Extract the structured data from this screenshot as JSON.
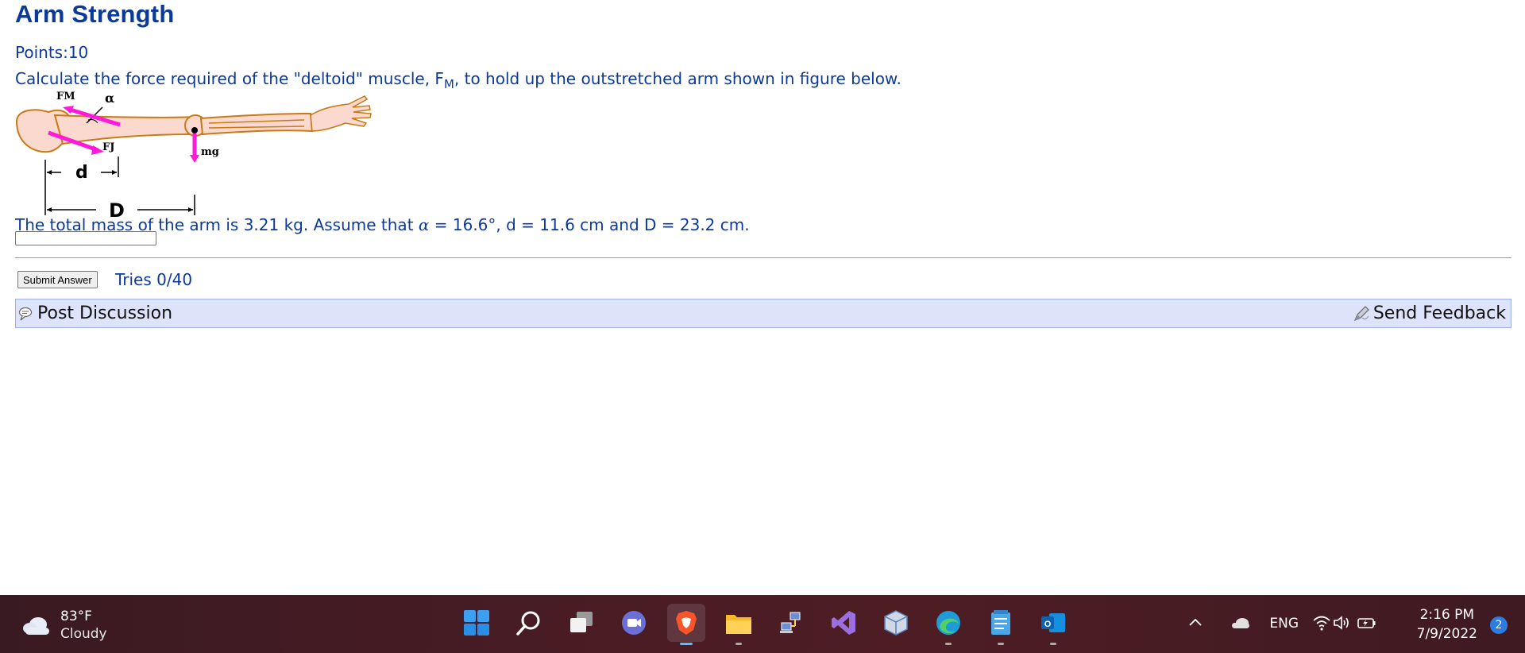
{
  "problem": {
    "title": "Arm Strength",
    "points": "Points:10",
    "question_pre": "Calculate the force required of the \"deltoid\" muscle, F",
    "question_sub": "M",
    "question_post": ", to hold up the outstretched arm shown in figure below.",
    "mass_text_pre": "The total mass of the arm is 3.21 kg. Assume that ",
    "alpha_symbol": "α",
    "mass_text_post": " = 16.6°, d = 11.6 cm and D = 23.2 cm.",
    "answer_value": "",
    "submit_label": "Submit Answer",
    "tries": "Tries 0/40",
    "post_discussion": "Post Discussion",
    "send_feedback": "Send Feedback"
  },
  "figure": {
    "label_fm": "FM",
    "label_alpha": "α",
    "label_fj": "FJ",
    "label_mg": "mg",
    "label_d": "d",
    "label_D": "D"
  },
  "taskbar": {
    "temperature": "83°F",
    "condition": "Cloudy",
    "icons": [
      "windows-start",
      "search",
      "task-view",
      "teams-chat",
      "brave-browser",
      "file-explorer",
      "network-app",
      "visual-studio",
      "virtualbox",
      "edge-browser",
      "notepad",
      "outlook"
    ],
    "language": "ENG",
    "time": "2:16 PM",
    "date": "7/9/2022",
    "notification_count": "2"
  },
  "colors": {
    "heading": "#0b3a9a",
    "arm_skin": "#fbd9cf",
    "arm_outline": "#c77a16",
    "force_arrow": "#ff19d8",
    "discussion_bar": "#dde3fb",
    "taskbar_bg": "#4a1c24",
    "active_indicator": "#4cc2ff"
  }
}
